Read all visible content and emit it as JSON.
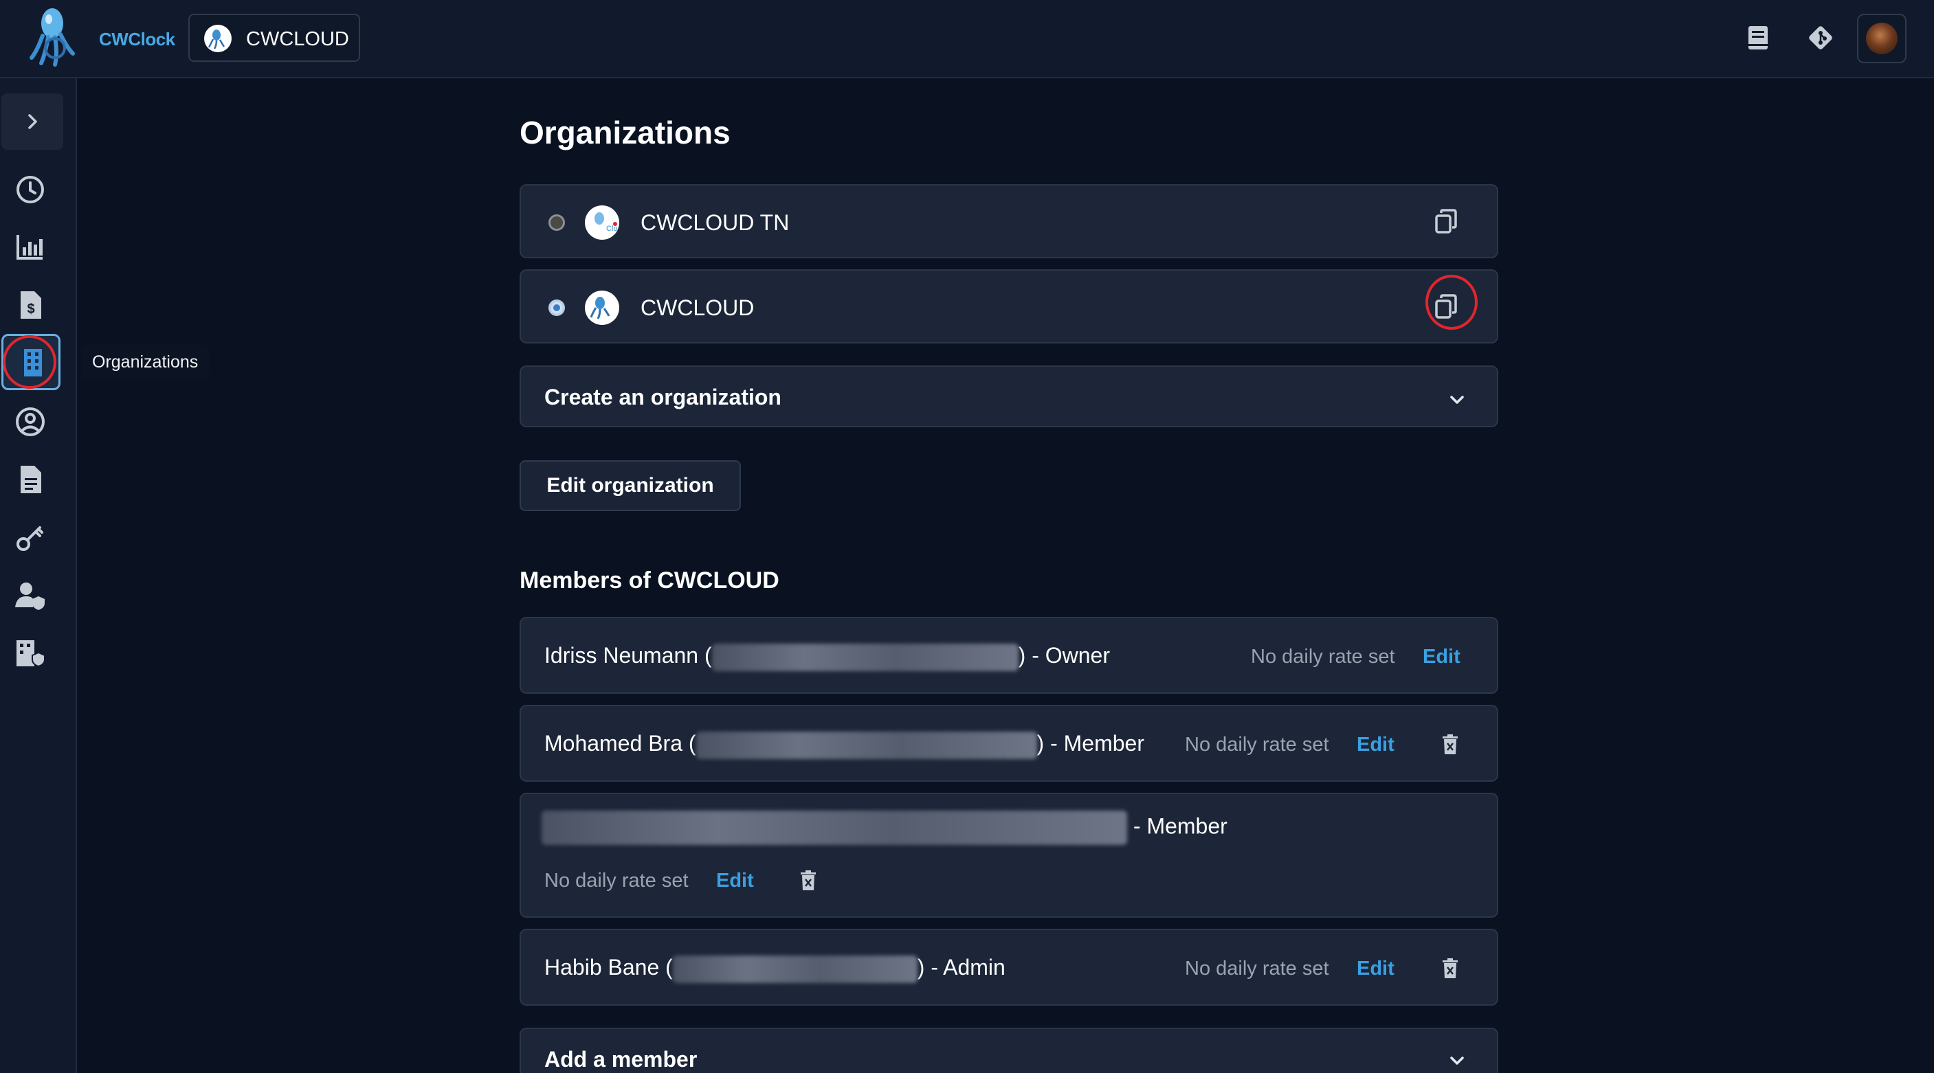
{
  "header": {
    "brand_name": "CWClock",
    "org_switcher_label": "CWCLOUD",
    "icons": [
      "docs-icon",
      "git-icon",
      "user-avatar"
    ]
  },
  "sidebar": {
    "tooltip": "Organizations",
    "items": [
      {
        "icon": "clock-icon"
      },
      {
        "icon": "bar-chart-icon"
      },
      {
        "icon": "invoice-icon"
      },
      {
        "icon": "building-icon",
        "active": true
      },
      {
        "icon": "user-circle-icon"
      },
      {
        "icon": "document-icon"
      },
      {
        "icon": "key-icon"
      },
      {
        "icon": "user-shield-icon"
      },
      {
        "icon": "building-shield-icon"
      }
    ]
  },
  "main": {
    "title": "Organizations",
    "organizations": [
      {
        "name": "CWCLOUD TN",
        "selected": false
      },
      {
        "name": "CWCLOUD",
        "selected": true
      }
    ],
    "create_org_label": "Create an organization",
    "edit_org_label": "Edit organization",
    "members_title": "Members of CWCLOUD",
    "members": [
      {
        "name": "Idriss Neumann (",
        "role": ") - Owner",
        "rate": "No daily rate set",
        "edit": "Edit"
      },
      {
        "name": "Mohamed Bra (",
        "role": ") - Member",
        "rate": "No daily rate set",
        "edit": "Edit"
      },
      {
        "name": "",
        "role": " - Member",
        "rate": "No daily rate set",
        "edit": "Edit"
      },
      {
        "name": "Habib Bane (",
        "role": ") - Admin",
        "rate": "No daily rate set",
        "edit": "Edit"
      }
    ],
    "add_member_label": "Add a member"
  },
  "colors": {
    "background": "#0a1120",
    "card": "#1c2638",
    "accent_link": "#3aa0e2",
    "highlight_ring": "#e0262e"
  }
}
